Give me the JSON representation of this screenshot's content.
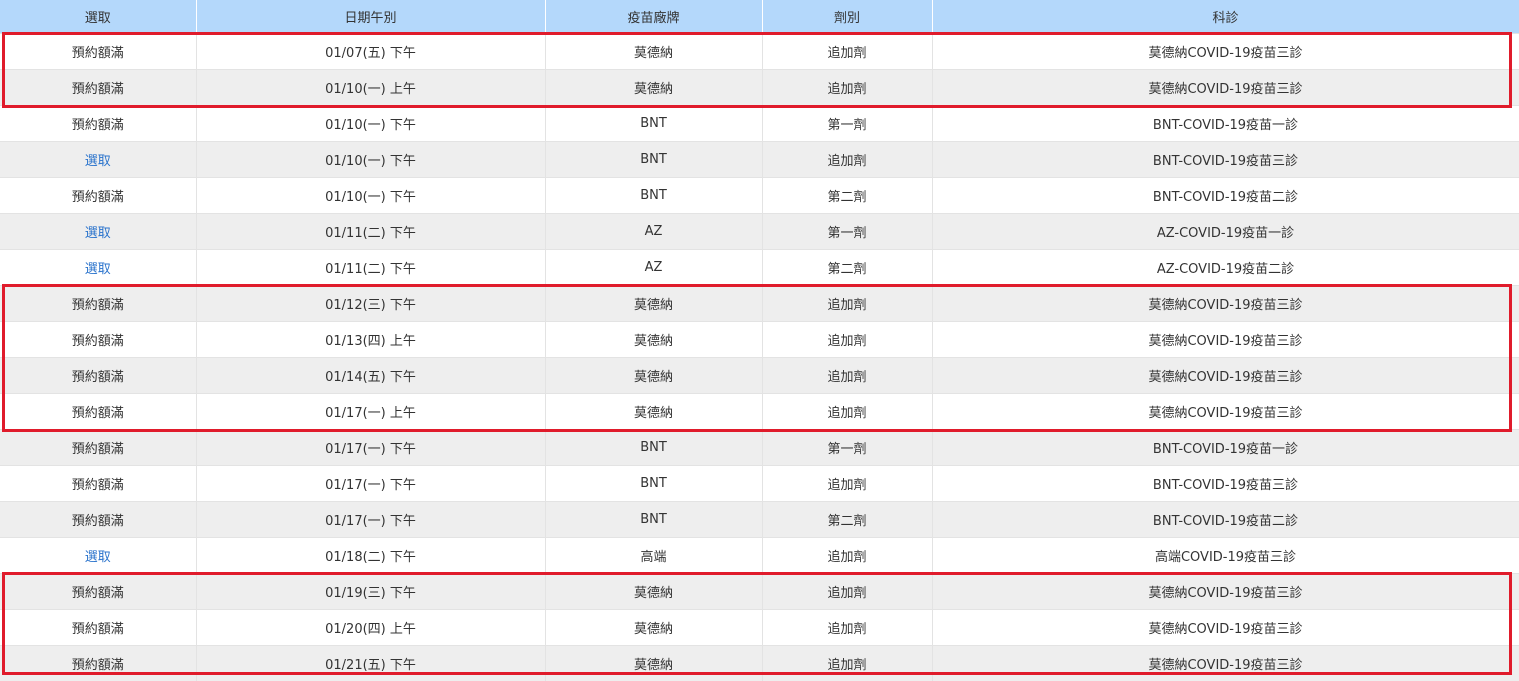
{
  "headers": [
    "選取",
    "日期午別",
    "疫苗廠牌",
    "劑別",
    "科診"
  ],
  "rows": [
    {
      "select": "預約額滿",
      "selectable": false,
      "date": "01/07(五) 下午",
      "brand": "莫德納",
      "dose": "追加劑",
      "clinic": "莫德納COVID-19疫苗三診"
    },
    {
      "select": "預約額滿",
      "selectable": false,
      "date": "01/10(一) 上午",
      "brand": "莫德納",
      "dose": "追加劑",
      "clinic": "莫德納COVID-19疫苗三診"
    },
    {
      "select": "預約額滿",
      "selectable": false,
      "date": "01/10(一) 下午",
      "brand": "BNT",
      "dose": "第一劑",
      "clinic": "BNT-COVID-19疫苗一診"
    },
    {
      "select": "選取",
      "selectable": true,
      "date": "01/10(一) 下午",
      "brand": "BNT",
      "dose": "追加劑",
      "clinic": "BNT-COVID-19疫苗三診"
    },
    {
      "select": "預約額滿",
      "selectable": false,
      "date": "01/10(一) 下午",
      "brand": "BNT",
      "dose": "第二劑",
      "clinic": "BNT-COVID-19疫苗二診"
    },
    {
      "select": "選取",
      "selectable": true,
      "date": "01/11(二) 下午",
      "brand": "AZ",
      "dose": "第一劑",
      "clinic": "AZ-COVID-19疫苗一診"
    },
    {
      "select": "選取",
      "selectable": true,
      "date": "01/11(二) 下午",
      "brand": "AZ",
      "dose": "第二劑",
      "clinic": "AZ-COVID-19疫苗二診"
    },
    {
      "select": "預約額滿",
      "selectable": false,
      "date": "01/12(三) 下午",
      "brand": "莫德納",
      "dose": "追加劑",
      "clinic": "莫德納COVID-19疫苗三診"
    },
    {
      "select": "預約額滿",
      "selectable": false,
      "date": "01/13(四) 上午",
      "brand": "莫德納",
      "dose": "追加劑",
      "clinic": "莫德納COVID-19疫苗三診"
    },
    {
      "select": "預約額滿",
      "selectable": false,
      "date": "01/14(五) 下午",
      "brand": "莫德納",
      "dose": "追加劑",
      "clinic": "莫德納COVID-19疫苗三診"
    },
    {
      "select": "預約額滿",
      "selectable": false,
      "date": "01/17(一) 上午",
      "brand": "莫德納",
      "dose": "追加劑",
      "clinic": "莫德納COVID-19疫苗三診"
    },
    {
      "select": "預約額滿",
      "selectable": false,
      "date": "01/17(一) 下午",
      "brand": "BNT",
      "dose": "第一劑",
      "clinic": "BNT-COVID-19疫苗一診"
    },
    {
      "select": "預約額滿",
      "selectable": false,
      "date": "01/17(一) 下午",
      "brand": "BNT",
      "dose": "追加劑",
      "clinic": "BNT-COVID-19疫苗三診"
    },
    {
      "select": "預約額滿",
      "selectable": false,
      "date": "01/17(一) 下午",
      "brand": "BNT",
      "dose": "第二劑",
      "clinic": "BNT-COVID-19疫苗二診"
    },
    {
      "select": "選取",
      "selectable": true,
      "date": "01/18(二) 下午",
      "brand": "高端",
      "dose": "追加劑",
      "clinic": "高端COVID-19疫苗三診"
    },
    {
      "select": "預約額滿",
      "selectable": false,
      "date": "01/19(三) 下午",
      "brand": "莫德納",
      "dose": "追加劑",
      "clinic": "莫德納COVID-19疫苗三診"
    },
    {
      "select": "預約額滿",
      "selectable": false,
      "date": "01/20(四) 上午",
      "brand": "莫德納",
      "dose": "追加劑",
      "clinic": "莫德納COVID-19疫苗三診"
    },
    {
      "select": "預約額滿",
      "selectable": false,
      "date": "01/21(五) 下午",
      "brand": "莫德納",
      "dose": "追加劑",
      "clinic": "莫德納COVID-19疫苗三診"
    }
  ],
  "highlight_groups": [
    {
      "first_row": 0,
      "last_row": 1
    },
    {
      "first_row": 7,
      "last_row": 10
    },
    {
      "first_row": 15,
      "last_row": 17
    }
  ],
  "colors": {
    "header_bg": "#b4d8fb",
    "row_alt_bg": "#eeeeee",
    "link": "#2a73cc",
    "highlight_border": "#e01b2b"
  }
}
